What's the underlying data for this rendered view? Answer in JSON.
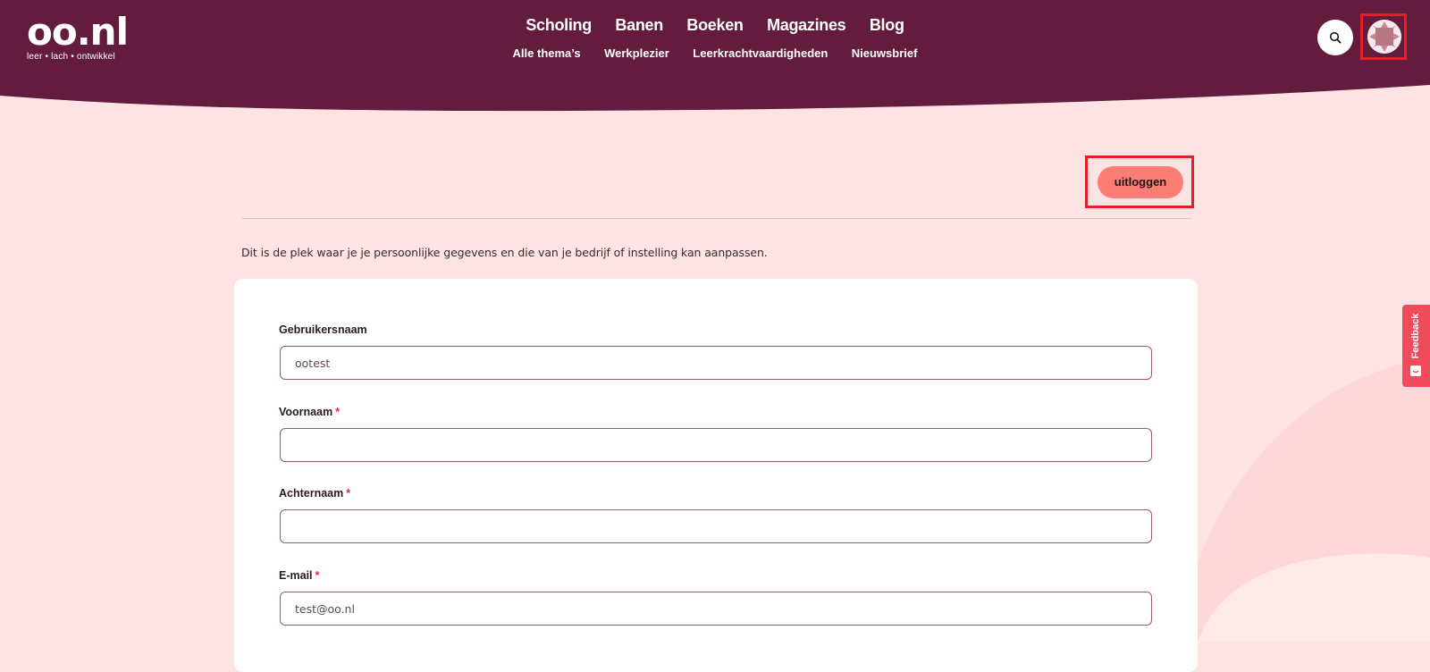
{
  "header": {
    "logo_text": "oo.nl",
    "logo_tagline": "leer • lach • ontwikkel",
    "main_nav": [
      {
        "label": "Scholing"
      },
      {
        "label": "Banen"
      },
      {
        "label": "Boeken"
      },
      {
        "label": "Magazines"
      },
      {
        "label": "Blog"
      }
    ],
    "sub_nav": [
      {
        "label": "Alle thema’s"
      },
      {
        "label": "Werkplezier"
      },
      {
        "label": "Leerkrachtvaardigheden"
      },
      {
        "label": "Nieuwsbrief"
      }
    ],
    "search_icon": "search-icon",
    "avatar_icon": "avatar"
  },
  "account": {
    "logout_label": "uitloggen",
    "intro_text": "Dit is de plek waar je je persoonlijke gegevens en die van je bedrijf of instelling kan aanpassen."
  },
  "form": {
    "fields": [
      {
        "label": "Gebruikersnaam",
        "required": false,
        "required_mark": "",
        "value": "ootest"
      },
      {
        "label": "Voornaam",
        "required": true,
        "required_mark": "*",
        "value": ""
      },
      {
        "label": "Achternaam",
        "required": true,
        "required_mark": "*",
        "value": ""
      },
      {
        "label": "E-mail",
        "required": true,
        "required_mark": "*",
        "value": "test@oo.nl"
      }
    ]
  },
  "feedback": {
    "label": "Feedback"
  },
  "colors": {
    "header_bg": "#631c3e",
    "page_bg": "#fee3e4",
    "accent_button": "#fb7d73",
    "highlight_frame": "#e51e2a",
    "feedback_tab": "#f04b5b",
    "input_border": "#9b5a6c"
  }
}
